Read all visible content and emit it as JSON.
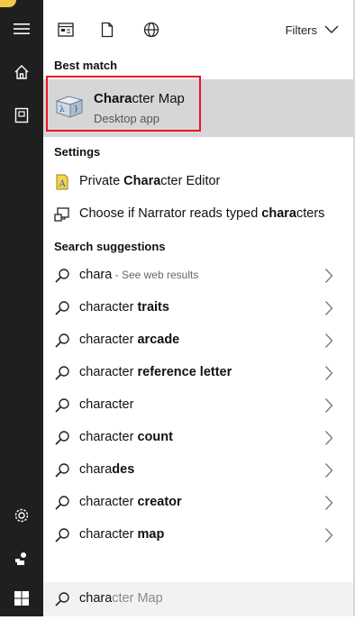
{
  "sidebar": {
    "items": [
      {
        "name": "hamburger-menu-icon"
      },
      {
        "name": "home-icon"
      },
      {
        "name": "notebook-icon"
      },
      {
        "name": "settings-gear-icon"
      },
      {
        "name": "feedback-icon"
      },
      {
        "name": "windows-start-icon"
      }
    ]
  },
  "topbar": {
    "tabs": [
      {
        "name": "apps-tab-icon"
      },
      {
        "name": "documents-tab-icon"
      },
      {
        "name": "web-tab-icon"
      }
    ],
    "filters_label": "Filters"
  },
  "best_match": {
    "heading": "Best match",
    "title_bold": "Chara",
    "title_rest": "cter Map",
    "subtitle": "Desktop app",
    "icon": "character-map-app-icon"
  },
  "settings": {
    "heading": "Settings",
    "items": [
      {
        "before": "Private ",
        "bold": "Chara",
        "after": "cter Editor",
        "icon": "private-character-editor-icon"
      },
      {
        "before": "Choose if Narrator reads typed ",
        "bold": "chara",
        "after": "cters",
        "icon": "narrator-settings-icon"
      }
    ]
  },
  "suggestions": {
    "heading": "Search suggestions",
    "items": [
      {
        "plain": "chara",
        "bold": "",
        "muted": " - See web results"
      },
      {
        "plain": "character",
        "bold": " traits",
        "muted": ""
      },
      {
        "plain": "character",
        "bold": " arcade",
        "muted": ""
      },
      {
        "plain": "character",
        "bold": " reference letter",
        "muted": ""
      },
      {
        "plain": "character",
        "bold": "",
        "muted": ""
      },
      {
        "plain": "character",
        "bold": " count",
        "muted": ""
      },
      {
        "plain": "chara",
        "bold": "des",
        "muted": ""
      },
      {
        "plain": "character",
        "bold": " creator",
        "muted": ""
      },
      {
        "plain": "character",
        "bold": " map",
        "muted": ""
      }
    ]
  },
  "search": {
    "typed": "chara",
    "completion": "cter Map"
  },
  "colors": {
    "sidebar_bg": "#1f1f1f",
    "highlight_bg": "#d6d6d6",
    "red_outline": "#e81123"
  }
}
